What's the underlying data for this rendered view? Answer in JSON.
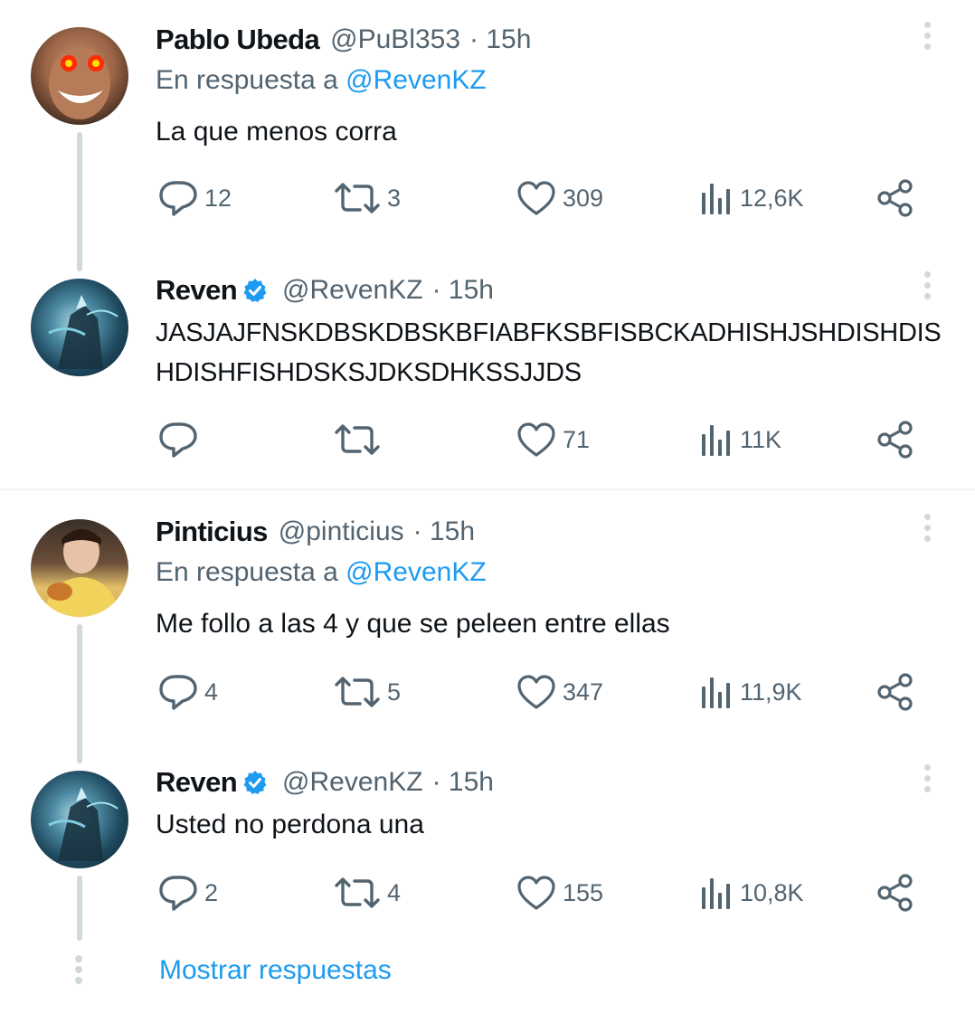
{
  "tweets": [
    {
      "name": "Pablo Ubeda",
      "handle": "@PuBl353",
      "time": "· 15h",
      "reply_prefix": "En respuesta a",
      "reply_mention": "@RevenKZ",
      "text": "La que menos corra",
      "replies": "12",
      "retweets": "3",
      "likes": "309",
      "views": "12,6K"
    },
    {
      "name": "Reven",
      "handle": "@RevenKZ",
      "time": "· 15h",
      "text": "JASJAJFNSKDBSKDBSKBFIABFKSBFISBCKADHISHJSHDISHDISHDISHFISHDSKSJDKSDHKSSJJDS",
      "replies": "",
      "retweets": "",
      "likes": "71",
      "views": "11K"
    },
    {
      "name": "Pinticius",
      "handle": "@pinticius",
      "time": "· 15h",
      "reply_prefix": "En respuesta a",
      "reply_mention": "@RevenKZ",
      "text": "Me follo a las 4 y que se peleen entre ellas",
      "replies": "4",
      "retweets": "5",
      "likes": "347",
      "views": "11,9K"
    },
    {
      "name": "Reven",
      "handle": "@RevenKZ",
      "time": "· 15h",
      "text": "Usted no perdona una",
      "replies": "2",
      "retweets": "4",
      "likes": "155",
      "views": "10,8K"
    }
  ],
  "show_replies": "Mostrar respuestas",
  "colors": {
    "accent": "#1d9bf0",
    "muted": "#536471",
    "line": "#cfd9de"
  },
  "icons": [
    "reply-icon",
    "retweet-icon",
    "like-icon",
    "views-icon",
    "share-icon",
    "more-icon",
    "verified-badge-icon"
  ]
}
